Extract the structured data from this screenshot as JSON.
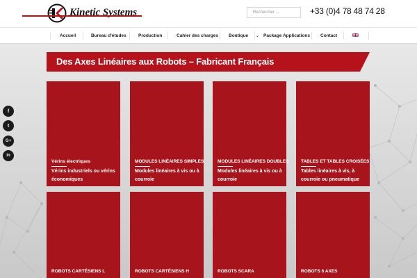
{
  "brand": {
    "name": "Kinetic Systems",
    "accent": "#b5121b"
  },
  "search": {
    "placeholder": "Rechercher ..."
  },
  "phone": "+33 (0)4 78 48 74 28",
  "nav": {
    "items": [
      {
        "label": "Accueil"
      },
      {
        "label": "Bureau d'études"
      },
      {
        "label": "Production"
      },
      {
        "label": "Cahier des charges"
      },
      {
        "label": "Boutique"
      },
      {
        "label": "Package Applications"
      },
      {
        "label": "Contact"
      }
    ],
    "language_icon": "uk-flag-icon"
  },
  "banner": {
    "title": "Des Axes Linéaires aux Robots  –  Fabricant Français"
  },
  "tiles": [
    {
      "title": "Vérins électriques",
      "desc": "Vérins industriels ou vérins économiques"
    },
    {
      "title": "MODULES LINÉAIRES SIMPLES",
      "desc": "Modules linéaires à vis ou à courroie"
    },
    {
      "title": "MODULES LINÉAIRES DOUBLES",
      "desc": "Modules linéaires à vis ou à courroie"
    },
    {
      "title": "TABLES ET TABLES CROISÉES",
      "desc": "Tables linéaires à vis, à courroie ou pneumatique"
    },
    {
      "title": "ROBOTS CARTÉSIENS L"
    },
    {
      "title": "ROBOTS CARTÉSIENS H"
    },
    {
      "title": "ROBOTS SCARA"
    },
    {
      "title": "ROBOTS 6 AXES"
    }
  ],
  "social": [
    {
      "icon": "facebook-icon",
      "glyph": "f"
    },
    {
      "icon": "twitter-icon",
      "glyph": "t"
    },
    {
      "icon": "googleplus-icon",
      "glyph": "G+"
    },
    {
      "icon": "linkedin-icon",
      "glyph": "in"
    }
  ]
}
